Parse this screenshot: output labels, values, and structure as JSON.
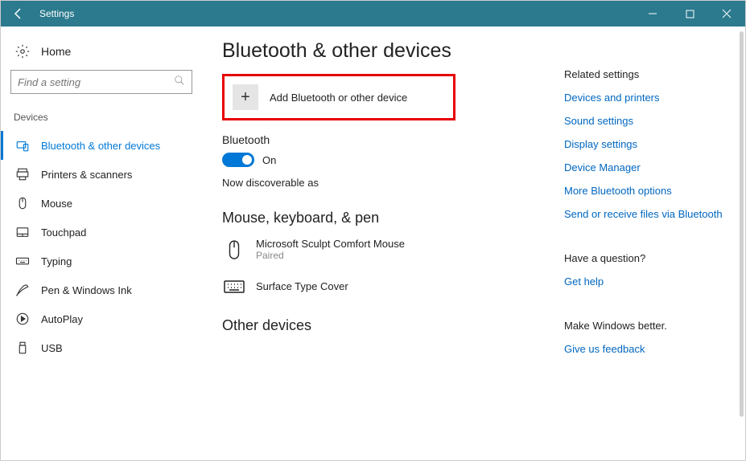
{
  "titlebar": {
    "title": "Settings"
  },
  "sidebar": {
    "home": "Home",
    "search_placeholder": "Find a setting",
    "section": "Devices",
    "items": [
      {
        "label": "Bluetooth & other devices"
      },
      {
        "label": "Printers & scanners"
      },
      {
        "label": "Mouse"
      },
      {
        "label": "Touchpad"
      },
      {
        "label": "Typing"
      },
      {
        "label": "Pen & Windows Ink"
      },
      {
        "label": "AutoPlay"
      },
      {
        "label": "USB"
      }
    ]
  },
  "main": {
    "title": "Bluetooth & other devices",
    "add_device": "Add Bluetooth or other device",
    "bluetooth_label": "Bluetooth",
    "toggle_state": "On",
    "discoverable": "Now discoverable as",
    "section_mkp": "Mouse, keyboard, & pen",
    "devices": [
      {
        "name": "Microsoft Sculpt Comfort Mouse",
        "status": "Paired"
      },
      {
        "name": "Surface Type Cover",
        "status": ""
      }
    ],
    "section_other": "Other devices"
  },
  "right": {
    "related_heading": "Related settings",
    "links": [
      "Devices and printers",
      "Sound settings",
      "Display settings",
      "Device Manager",
      "More Bluetooth options",
      "Send or receive files via Bluetooth"
    ],
    "question_heading": "Have a question?",
    "get_help": "Get help",
    "better_heading": "Make Windows better.",
    "feedback": "Give us feedback"
  }
}
